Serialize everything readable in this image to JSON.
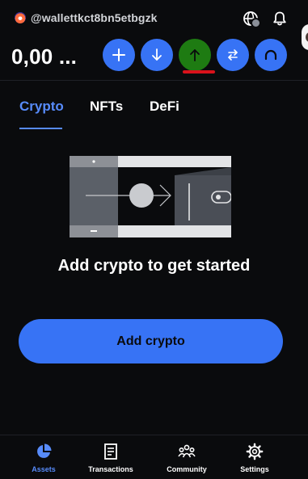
{
  "account": {
    "username": "@wallettkct8bn5etbgzk",
    "avatar_icon": "wallet-avatar"
  },
  "header_icons": [
    "globe-icon",
    "bell-icon"
  ],
  "balance": "0,00 ...",
  "actions": [
    {
      "name": "buy",
      "icon": "plus-icon"
    },
    {
      "name": "receive",
      "icon": "arrow-down-icon"
    },
    {
      "name": "send",
      "icon": "arrow-up-icon",
      "active": true,
      "active_color": "#1e7b12"
    },
    {
      "name": "swap",
      "icon": "swap-arrows-icon"
    },
    {
      "name": "bridge",
      "icon": "bridge-arc-icon"
    }
  ],
  "tabs": [
    {
      "label": "Crypto",
      "active": true
    },
    {
      "label": "NFTs"
    },
    {
      "label": "DeFi"
    }
  ],
  "empty_state": {
    "title": "Add crypto to get started",
    "button_label": "Add crypto"
  },
  "bottom_nav": [
    {
      "label": "Assets",
      "icon": "pie-chart-icon",
      "active": true
    },
    {
      "label": "Transactions",
      "icon": "document-icon"
    },
    {
      "label": "Community",
      "icon": "people-icon"
    },
    {
      "label": "Settings",
      "icon": "gear-icon"
    }
  ],
  "colors": {
    "background": "#0a0b0d",
    "accent_blue": "#3773f5",
    "accent_blue_text": "#578bfa",
    "active_green": "#1e7b12",
    "underline_red": "#d9121b"
  }
}
